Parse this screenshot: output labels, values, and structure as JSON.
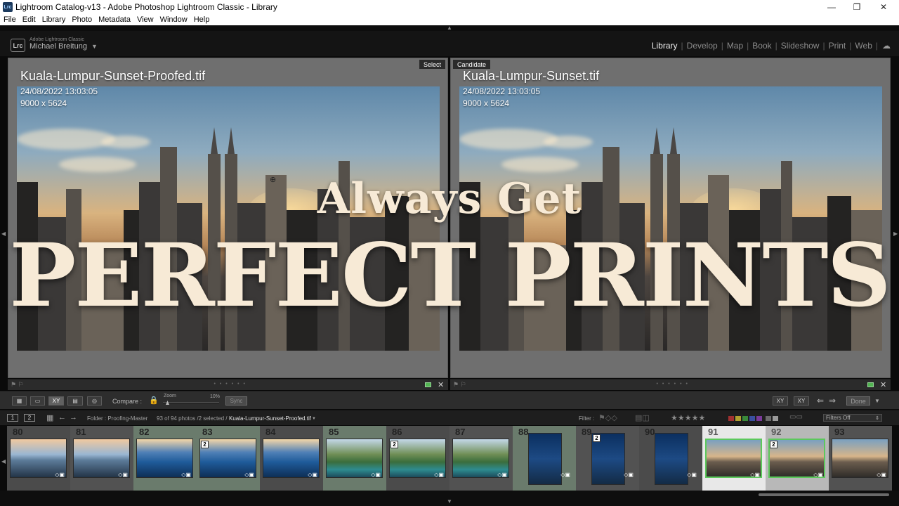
{
  "window": {
    "title": "Lightroom Catalog-v13 - Adobe Photoshop Lightroom Classic - Library",
    "app_icon": "Lrc",
    "controls": [
      "—",
      "❐",
      "✕"
    ]
  },
  "menu": [
    "File",
    "Edit",
    "Library",
    "Photo",
    "Metadata",
    "View",
    "Window",
    "Help"
  ],
  "identity": {
    "logo": "Lrc",
    "product": "Adobe Lightroom Classic",
    "user": "Michael Breitung",
    "arrow": "▼"
  },
  "modules": [
    "Library",
    "Develop",
    "Map",
    "Book",
    "Slideshow",
    "Print",
    "Web"
  ],
  "active_module": "Library",
  "cloud_icon": "☁",
  "compare": {
    "left": {
      "tag": "Select",
      "filename": "Kuala-Lumpur-Sunset-Proofed.tif",
      "date": "24/08/2022 13:03:05",
      "dims": "9000 x 5624"
    },
    "right": {
      "tag": "Candidate",
      "filename": "Kuala-Lumpur-Sunset.tif",
      "date": "24/08/2022 13:03:05",
      "dims": "9000 x 5624"
    }
  },
  "pane_footer": {
    "flags": "⚑ ⚐",
    "dots": "• • • • • •",
    "close": "✕"
  },
  "toolbar": {
    "view_grid": "▦",
    "view_loupe": "▭",
    "view_compare": "XY",
    "view_survey": "▤",
    "view_people": "◎",
    "compare_label": "Compare :",
    "zoom_label": "Zoom",
    "zoom_value": "10%",
    "zoom_fraction": 0.1,
    "sync_label": "Sync",
    "done_label": "Done",
    "swap_icon": "XY",
    "make_select_icon": "XY",
    "prev_icon": "⇐",
    "next_icon": "⇒"
  },
  "filmstrip_header": {
    "page1": "1",
    "page2": "2",
    "grid_icon": "▦",
    "back": "←",
    "forward": "→",
    "folder": "Folder : Proofing-Master",
    "count": "93 of 94 photos /2 selected /",
    "current": "Kuala-Lumpur-Sunset-Proofed.tif",
    "current_arrow": "▼",
    "filter_label": "Filter :",
    "stars": "★★★★★",
    "filters_off": "Filters Off",
    "colors": [
      "#a03030",
      "#b0a030",
      "#3a8a3a",
      "#3a4fa0",
      "#7a3a9a",
      "#6a6a6a",
      "#9a9a9a"
    ]
  },
  "filmstrip": [
    {
      "num": "80",
      "style": "th-marina",
      "badge": "",
      "sel": ""
    },
    {
      "num": "81",
      "style": "th-marina",
      "badge": "",
      "sel": ""
    },
    {
      "num": "82",
      "style": "th-blue",
      "badge": "",
      "sel": ""
    },
    {
      "num": "83",
      "style": "th-blue",
      "badge": "2",
      "sel": ""
    },
    {
      "num": "84",
      "style": "th-blue",
      "badge": "",
      "sel": ""
    },
    {
      "num": "85",
      "style": "th-coast",
      "badge": "",
      "sel": ""
    },
    {
      "num": "86",
      "style": "th-coast",
      "badge": "2",
      "sel": ""
    },
    {
      "num": "87",
      "style": "th-coast",
      "badge": "",
      "sel": ""
    },
    {
      "num": "88",
      "style": "th-night",
      "badge": "",
      "sel": "",
      "port": true
    },
    {
      "num": "89",
      "style": "th-night",
      "badge": "2",
      "sel": "",
      "port": true
    },
    {
      "num": "90",
      "style": "th-night",
      "badge": "",
      "sel": "",
      "port": true
    },
    {
      "num": "91",
      "style": "th-city",
      "badge": "",
      "sel": "sel"
    },
    {
      "num": "92",
      "style": "th-city",
      "badge": "2",
      "sel": "sel2"
    },
    {
      "num": "93",
      "style": "th-city",
      "badge": "",
      "sel": ""
    }
  ],
  "overlay": {
    "line1": "Always Get",
    "line2": "PERFECT PRINTS"
  }
}
